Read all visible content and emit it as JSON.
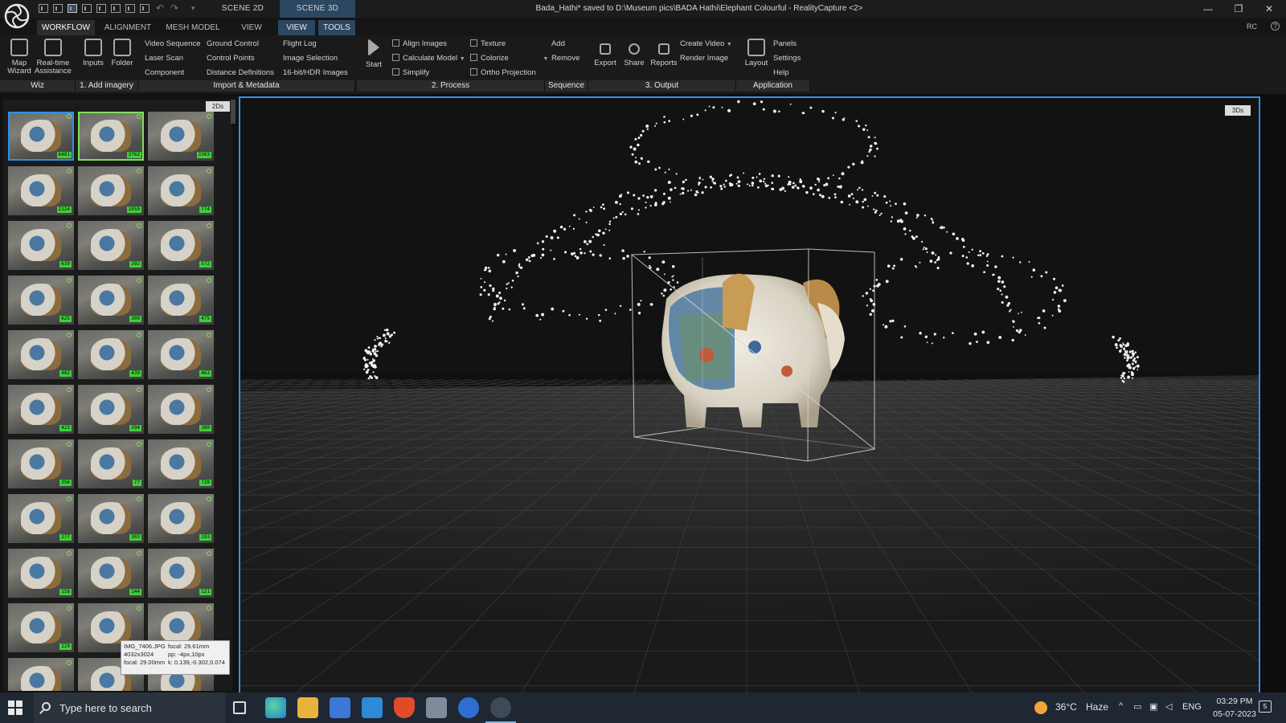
{
  "titlebar": {
    "scene_tabs": [
      "SCENE 2D",
      "SCENE 3D"
    ],
    "title": "Bada_Hathi* saved to D:\\Museum pics\\BADA Hathi\\Elephant Colourful - RealityCapture <2>",
    "window_controls": [
      "—",
      "❐",
      "✕"
    ]
  },
  "menu": {
    "tabs": [
      "WORKFLOW",
      "ALIGNMENT",
      "MESH MODEL",
      "VIEW",
      "VIEW",
      "TOOLS"
    ],
    "rc": "RC",
    "help": "?"
  },
  "ribbon": {
    "wiz": {
      "map_wizard": "Map\nWizard",
      "realtime": "Real-time\nAssistance",
      "label": "Wiz"
    },
    "add_imagery": {
      "inputs": "Inputs",
      "folder": "Folder",
      "label": "1. Add imagery"
    },
    "import": {
      "col1": [
        "Video Sequence",
        "Laser Scan",
        "Component"
      ],
      "col2": [
        "Ground Control",
        "Control Points",
        "Distance Definitions"
      ],
      "col3": [
        "Flight Log",
        "Image Selection",
        "16-bit/HDR Images"
      ],
      "label": "Import & Metadata"
    },
    "process": {
      "start": "Start",
      "col1": [
        "Align Images",
        "Calculate Model",
        "Simplify"
      ],
      "col2": [
        "Texture",
        "Colorize",
        "Ortho Projection"
      ],
      "label": "2. Process"
    },
    "sequence": {
      "items": [
        "Add",
        "Remove"
      ],
      "label": "Sequence"
    },
    "output": {
      "export": "Export",
      "share": "Share",
      "reports": "Reports",
      "items": [
        "Create Video",
        "Render Image"
      ],
      "label": "3. Output"
    },
    "application": {
      "layout": "Layout",
      "items": [
        "Panels",
        "Settings",
        "Help"
      ],
      "label": "Application"
    }
  },
  "left_panel": {
    "badge": "2Ds",
    "thumbnails": [
      "6481",
      "3762",
      "3303",
      "2124",
      "1059",
      "774",
      "639",
      "392",
      "572",
      "625",
      "300",
      "475",
      "482",
      "439",
      "463",
      "423",
      "394",
      "380",
      "356",
      "77",
      "728",
      "277",
      "303",
      "193",
      "158",
      "144",
      "121",
      "129",
      "92",
      "",
      "",
      "",
      ""
    ],
    "tooltip": {
      "name": "IMG_7406.JPG",
      "size": "4032x3024",
      "focal_left": "focal: 29.00mm",
      "focal_right": "focal: 29.61mm",
      "pp": "pp: -4px,10px",
      "k": "k: 0.139,-0.302,0.074"
    }
  },
  "viewport": {
    "badge": "3Ds"
  },
  "taskbar": {
    "search_placeholder": "Type here to search",
    "temperature": "36°C",
    "weather": "Haze",
    "lang": "ENG",
    "time": "03:29 PM",
    "date": "05-07-2023",
    "notifications": "5"
  },
  "colors": {
    "accent": "#3a8ee6",
    "active_tab": "#2c4761",
    "badge_green": "#3fcf3a"
  }
}
